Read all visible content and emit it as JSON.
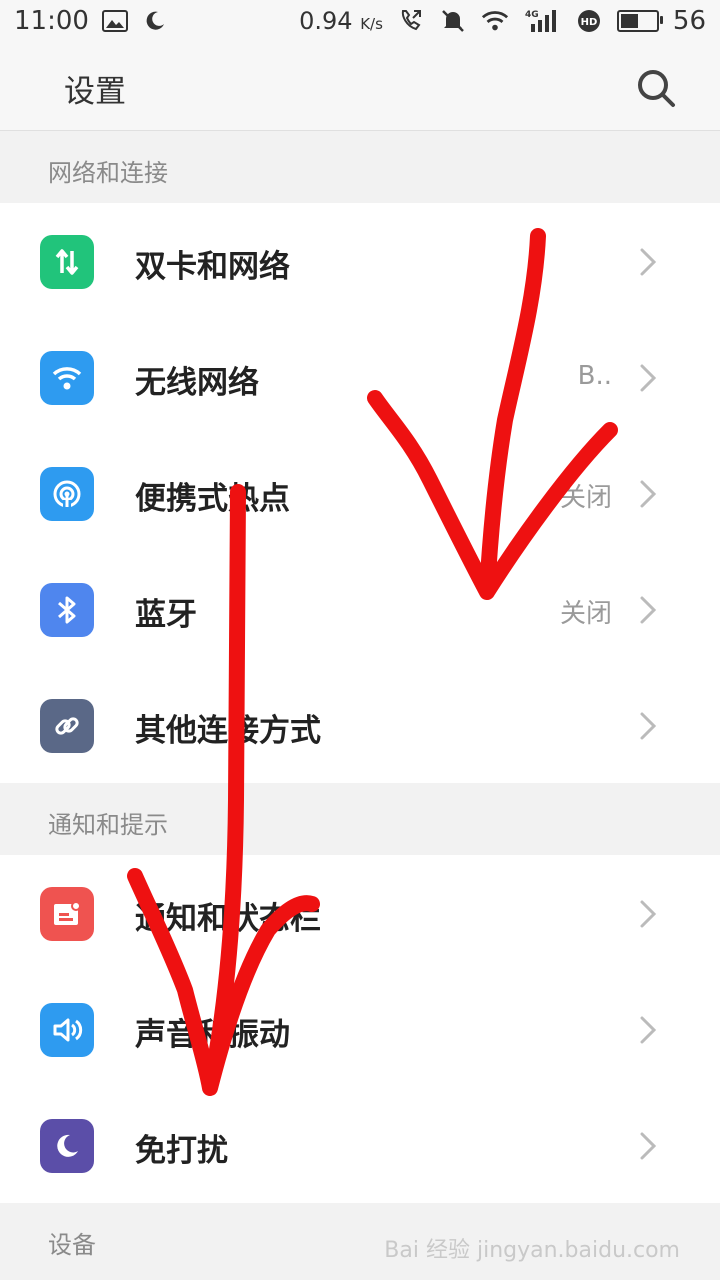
{
  "status": {
    "time": "11:00",
    "speed_value": "0.94",
    "speed_unit": "K/s",
    "network": "4G",
    "battery": "56",
    "battery_level": 0.56
  },
  "header": {
    "title": "设置"
  },
  "sections": [
    {
      "title": "网络和连接",
      "items": [
        {
          "label": "双卡和网络",
          "value": "",
          "icon": "sim-network-icon",
          "color": "#21c47b"
        },
        {
          "label": "无线网络",
          "value": "B..",
          "icon": "wifi-icon",
          "color": "#2e9bf0"
        },
        {
          "label": "便携式热点",
          "value": "关闭",
          "icon": "hotspot-icon",
          "color": "#2e9bf0"
        },
        {
          "label": "蓝牙",
          "value": "关闭",
          "icon": "bluetooth-icon",
          "color": "#4f86ee"
        },
        {
          "label": "其他连接方式",
          "value": "",
          "icon": "link-icon",
          "color": "#5a6887"
        }
      ]
    },
    {
      "title": "通知和提示",
      "items": [
        {
          "label": "通知和状态栏",
          "value": "",
          "icon": "notification-icon",
          "color": "#ef5350"
        },
        {
          "label": "声音和振动",
          "value": "",
          "icon": "sound-icon",
          "color": "#2e9bf0"
        },
        {
          "label": "免打扰",
          "value": "",
          "icon": "moon-icon",
          "color": "#5b4ea8"
        }
      ]
    },
    {
      "title": "设备",
      "items": []
    }
  ],
  "watermark": "Bai 经验 jingyan.baidu.com"
}
